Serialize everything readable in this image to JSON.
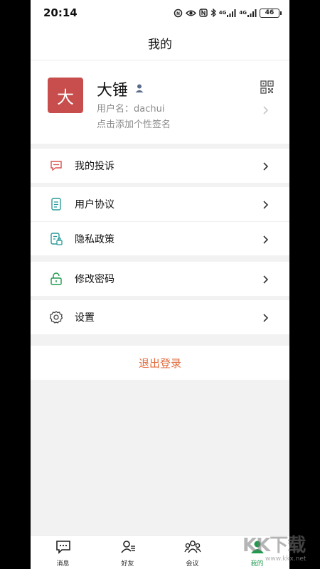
{
  "status_bar": {
    "time": "20:14",
    "battery": "46",
    "network_1": "4G",
    "network_2": "4G"
  },
  "header": {
    "title": "我的"
  },
  "profile": {
    "avatar_char": "大",
    "avatar_color": "#c84d4d",
    "nickname": "大锤",
    "username": "用户名：dachui",
    "signature": "点击添加个性签名"
  },
  "menu": {
    "complaints": "我的投诉",
    "user_agreement": "用户协议",
    "privacy_policy": "隐私政策",
    "change_password": "修改密码",
    "settings": "设置"
  },
  "logout": {
    "label": "退出登录",
    "color": "#e16a3a"
  },
  "tabbar": {
    "messages": "消息",
    "friends": "好友",
    "meetings": "会议",
    "mine": "我的",
    "active_color": "#1f9a4d"
  },
  "watermark": {
    "text": "KK下载",
    "url": "www.kkx.net"
  }
}
